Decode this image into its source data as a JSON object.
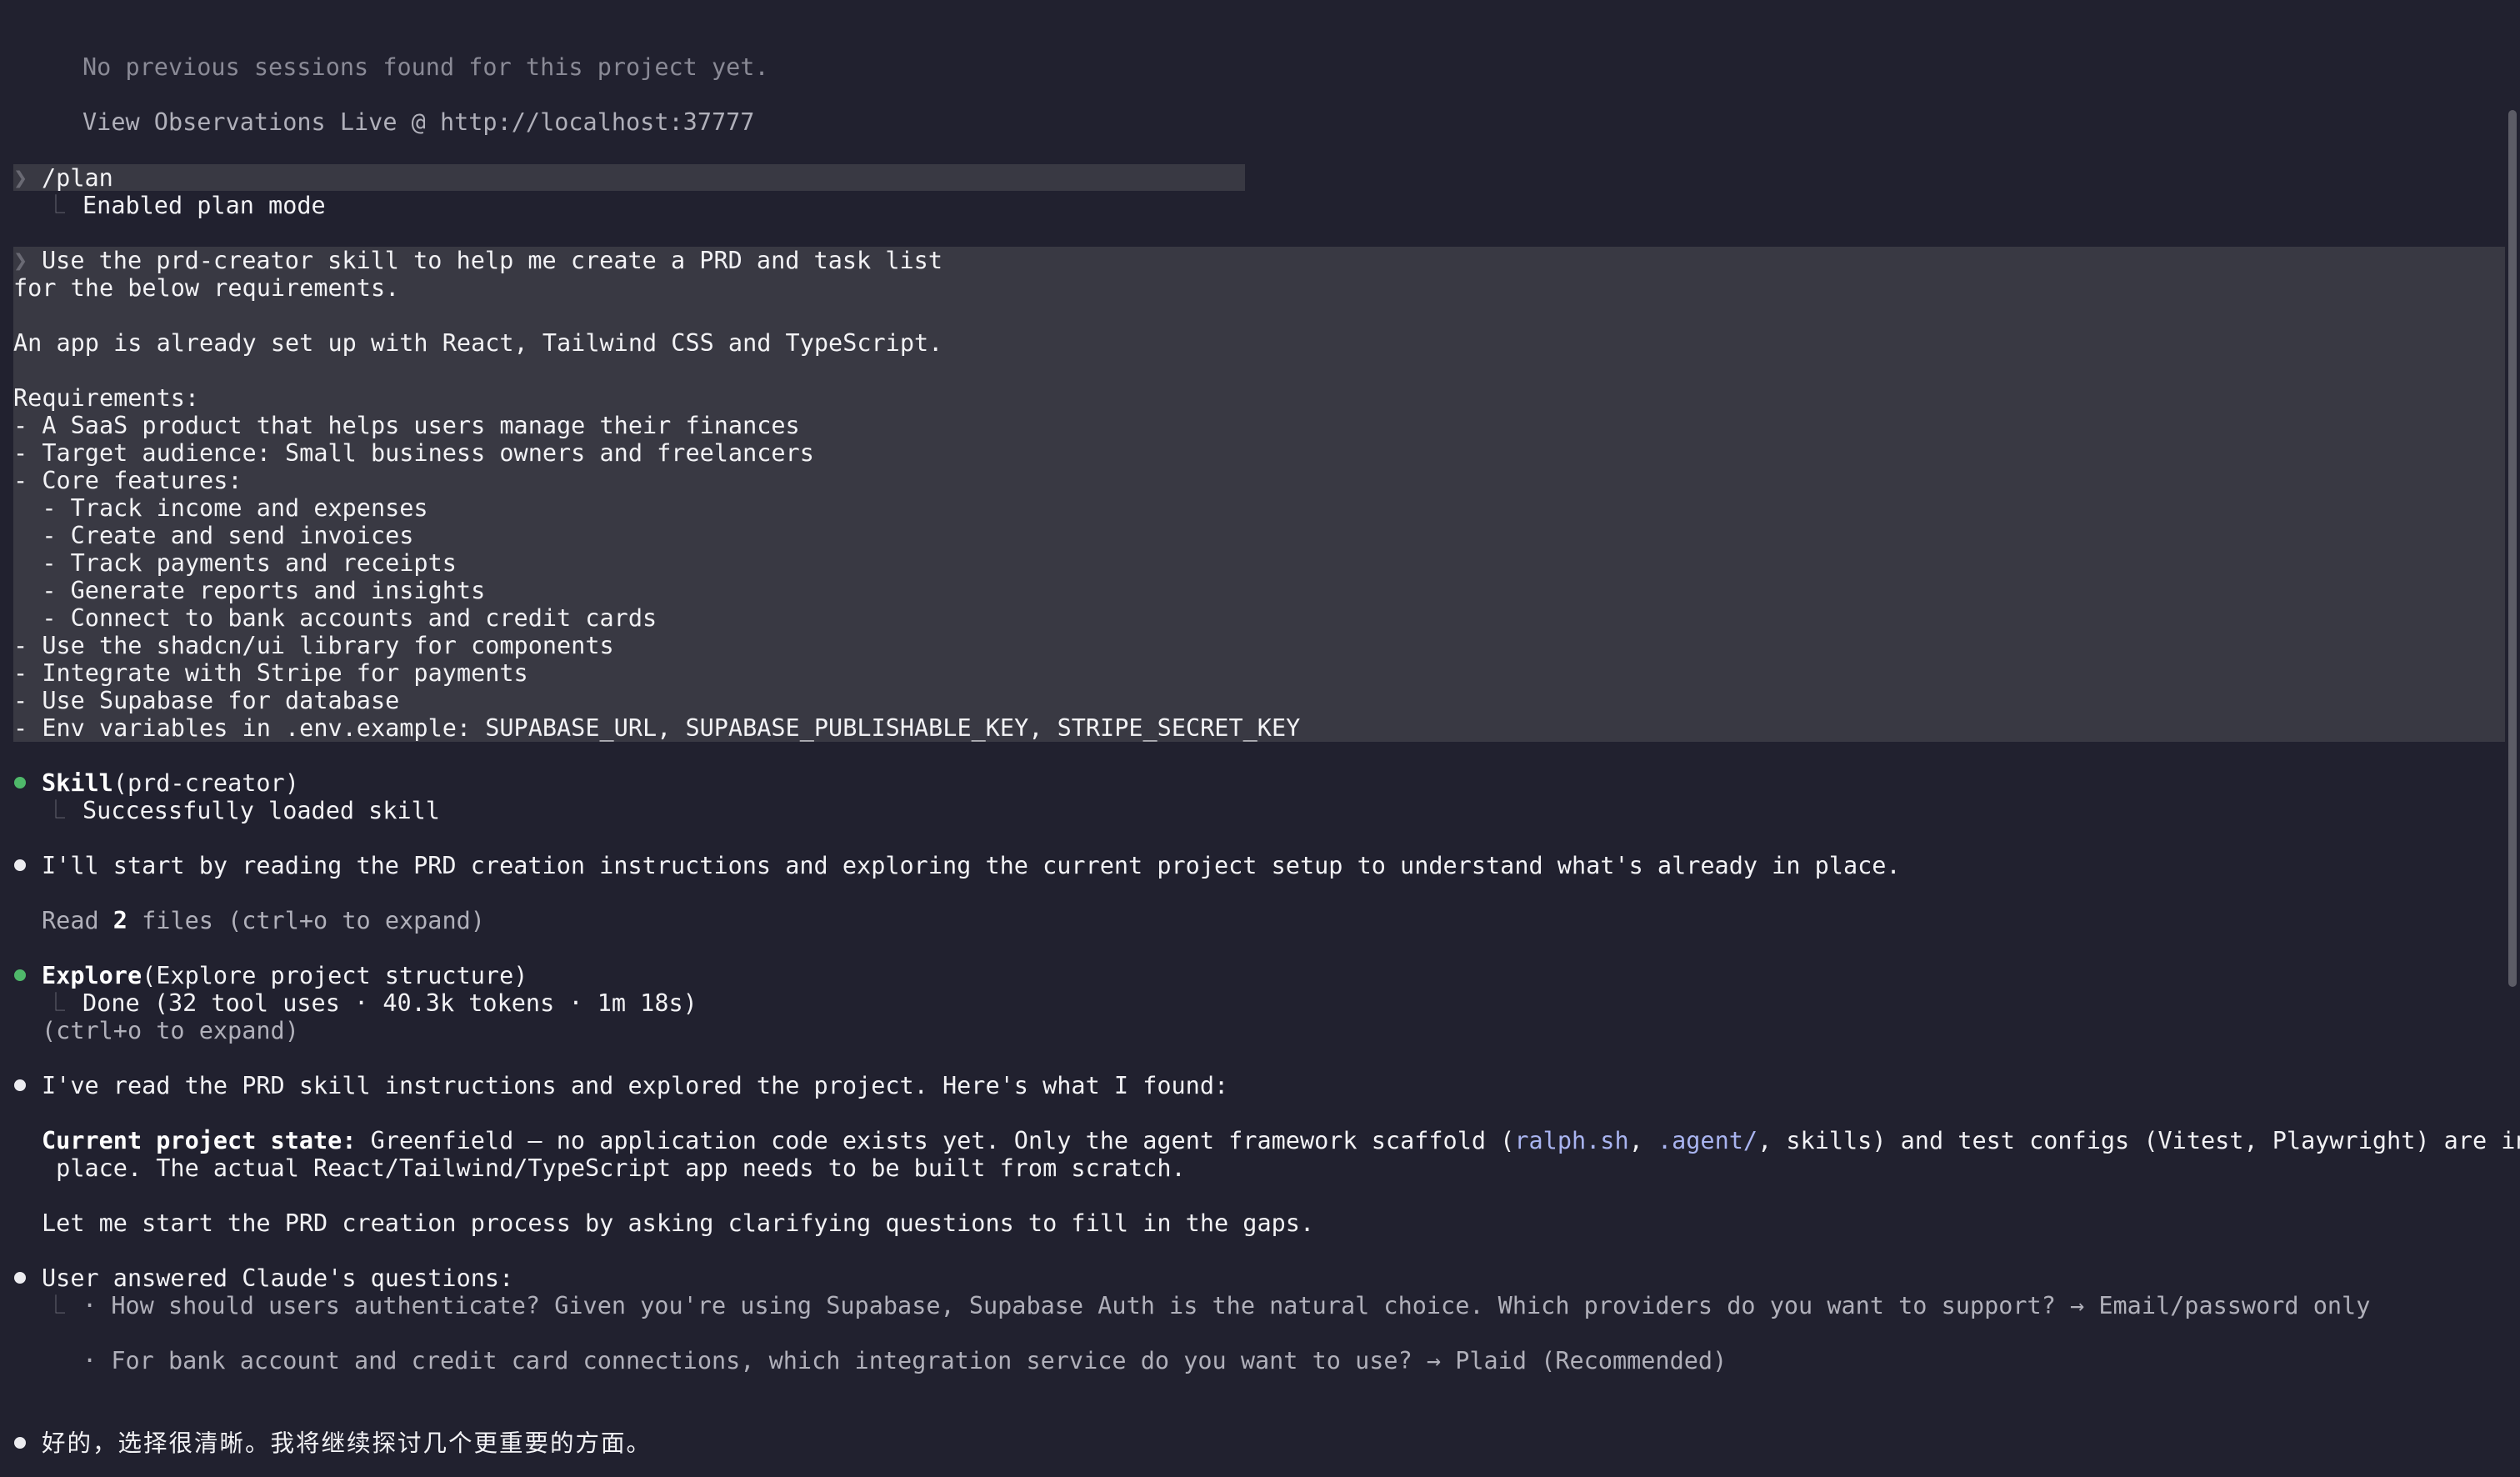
{
  "header": {
    "no_sessions": "No previous sessions found for this project yet.",
    "observations": "View Observations Live @ http://localhost:37777"
  },
  "plan_cmd": {
    "chevron": "❯",
    "command": "/plan",
    "elbow": "⎿",
    "result": "Enabled plan mode"
  },
  "user_prompt": {
    "chevron": "❯",
    "lines": [
      "Use the prd-creator skill to help me create a PRD and task list",
      "for the below requirements.",
      "",
      "An app is already set up with React, Tailwind CSS and TypeScript.",
      "",
      "Requirements:",
      "- A SaaS product that helps users manage their finances",
      "- Target audience: Small business owners and freelancers",
      "- Core features:",
      "  - Track income and expenses",
      "  - Create and send invoices",
      "  - Track payments and receipts",
      "  - Generate reports and insights",
      "  - Connect to bank accounts and credit cards",
      "- Use the shadcn/ui library for components",
      "- Integrate with Stripe for payments",
      "- Use Supabase for database",
      "- Env variables in .env.example: SUPABASE_URL, SUPABASE_PUBLISHABLE_KEY, STRIPE_SECRET_KEY"
    ]
  },
  "skill_call": {
    "name": "Skill",
    "arg": "(prd-creator)",
    "elbow": "⎿",
    "result": "Successfully loaded skill"
  },
  "msg_start": "I'll start by reading the PRD creation instructions and exploring the current project setup to understand what's already in place.",
  "read_files": {
    "pre": "Read ",
    "count": "2",
    "post": " files (ctrl+o to expand)"
  },
  "explore_call": {
    "name": "Explore",
    "arg": "(Explore project structure)",
    "elbow": "⎿",
    "result": "Done (32 tool uses · 40.3k tokens · 1m 18s)",
    "expand": "(ctrl+o to expand)"
  },
  "msg_found": "I've read the PRD skill instructions and explored the project. Here's what I found:",
  "project_state": {
    "label": "Current project state:",
    "text1": " Greenfield — no application code exists yet. Only the agent framework scaffold (",
    "link1": "ralph.sh",
    "sep": ", ",
    "link2": ".agent/",
    "text2": ", skills) and test configs (Vitest, Playwright) are in",
    "text3": " place. The actual React/Tailwind/TypeScript app needs to be built from scratch."
  },
  "msg_clarify": "Let me start the PRD creation process by asking clarifying questions to fill in the gaps.",
  "questions": {
    "title": "User answered Claude's questions:",
    "elbow": "⎿",
    "q1": "· How should users authenticate? Given you're using Supabase, Supabase Auth is the natural choice. Which providers do you want to support? → Email/password only",
    "q2": "· For bank account and credit card connections, which integration service do you want to use? → Plaid (Recommended)"
  },
  "msg_cn": "好的，选择很清晰。我将继续探讨几个更重要的方面。",
  "colors": {
    "background": "#21212f",
    "highlight": "#393943",
    "bullet_green": "#4fb86a",
    "link": "#a9b4f0"
  }
}
